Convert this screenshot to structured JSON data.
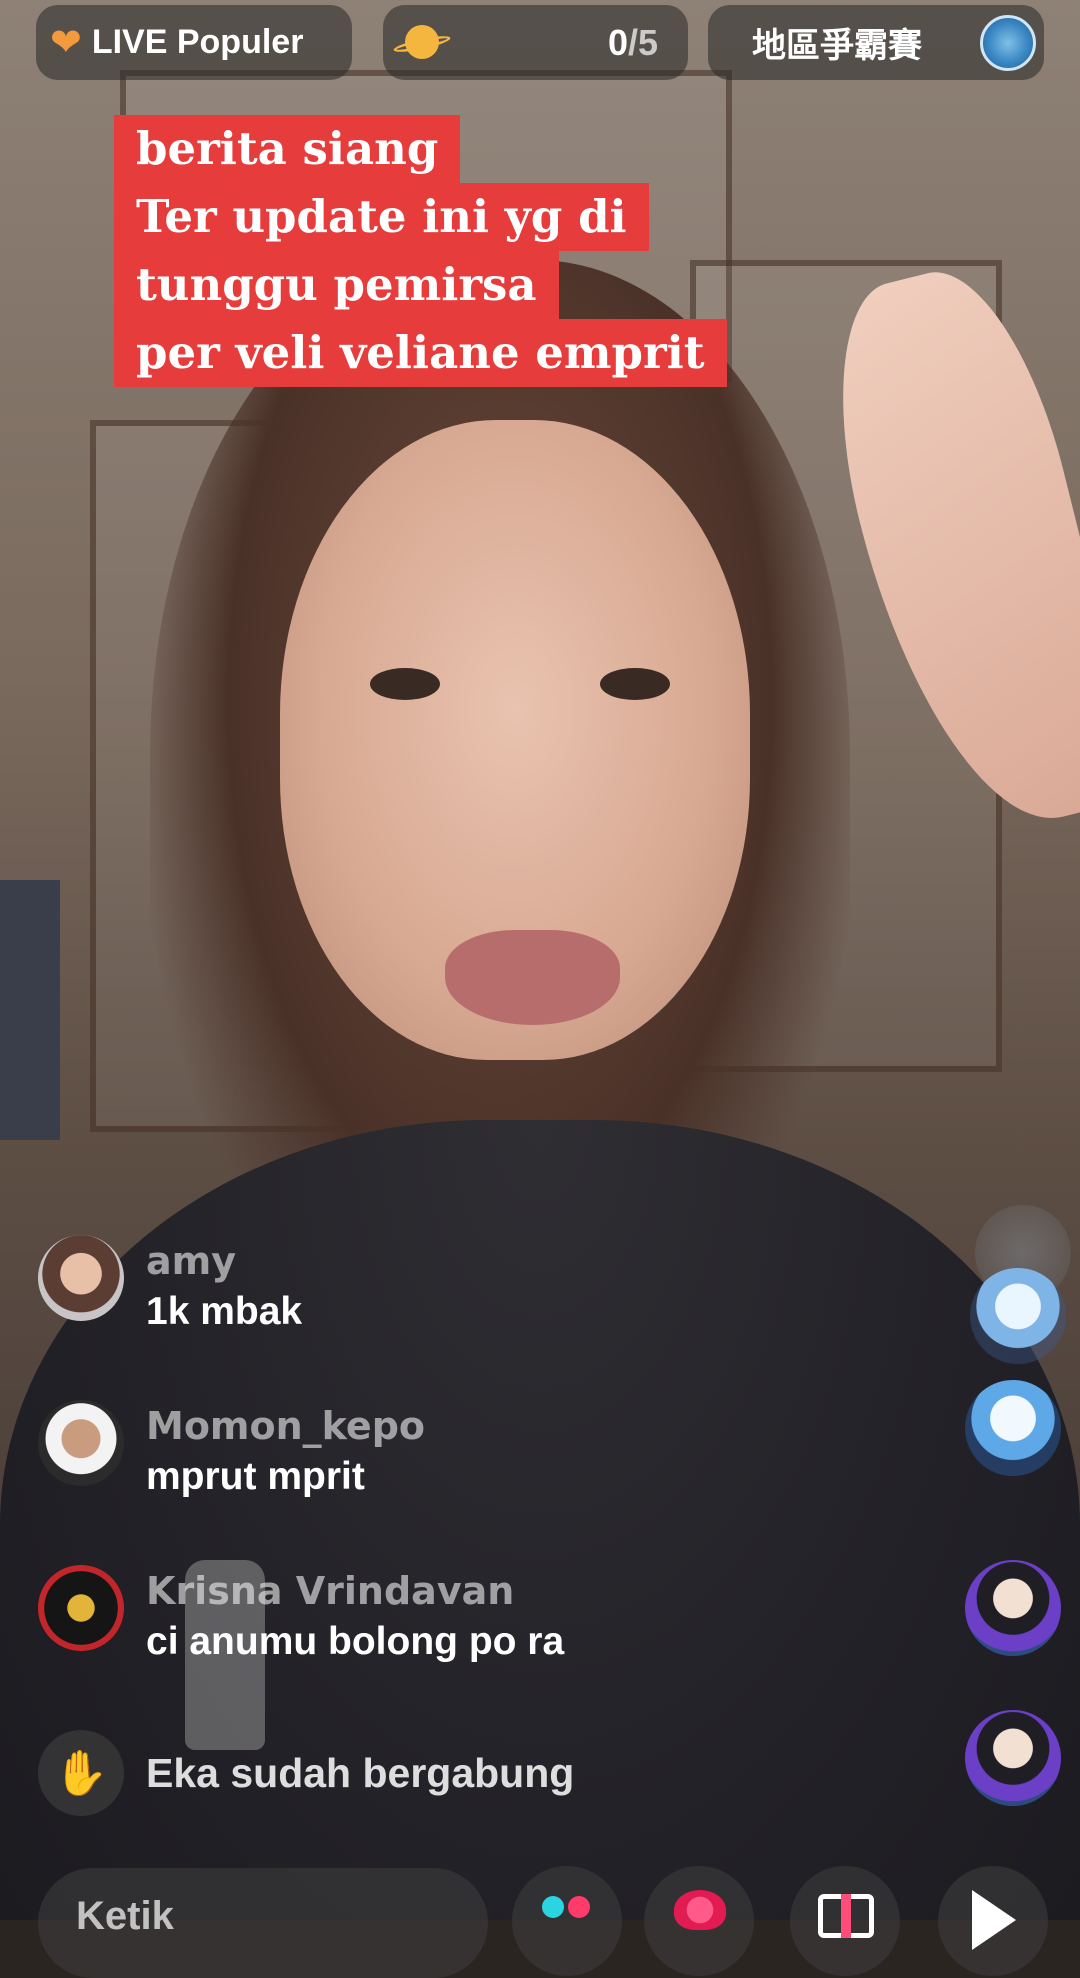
{
  "top_bar": {
    "live_label": "LIVE Populer",
    "goal_count": "0",
    "goal_total": "/5",
    "region_label": "地區爭霸賽"
  },
  "caption": {
    "lines": [
      "berita siang",
      "Ter update ini yg di",
      "tunggu pemirsa",
      "per veli veliane emprit"
    ]
  },
  "comments": [
    {
      "user": "amy",
      "message": "1k mbak"
    },
    {
      "user": "Momon_kepo",
      "message": "mprut mprit"
    },
    {
      "user": "Krisna Vrindavan",
      "message": "ci anumu bolong po ra"
    }
  ],
  "join_notice": "Eka sudah bergabung",
  "bottom_bar": {
    "input_placeholder": "Ketik"
  },
  "icons": {
    "live": "heart-icon",
    "goal": "planet-icon",
    "region": "region-badge-icon",
    "join": "wave-hand-icon",
    "effects": "dots-icon",
    "rose": "rose-icon",
    "gift": "gift-icon",
    "share": "share-arrow-icon"
  },
  "colors": {
    "caption_bg": "#e63c3c",
    "live_heart": "#f39a3c",
    "planet": "#f5b640"
  }
}
